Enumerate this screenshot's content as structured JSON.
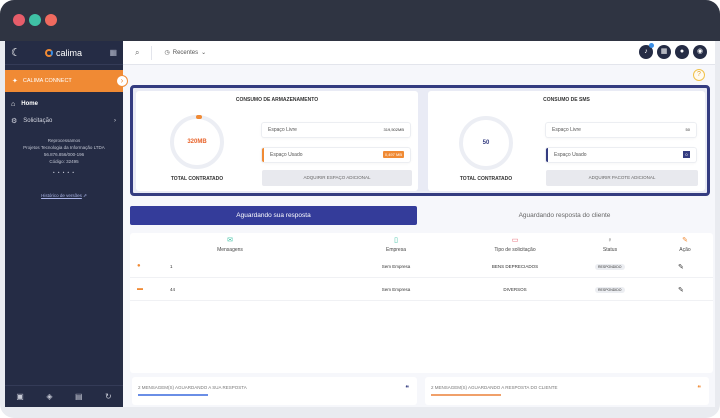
{
  "colors": {
    "brand_dark": "#252c45",
    "accent_orange": "#f08a34",
    "accent_indigo": "#343c9a",
    "accent_blue": "#3a8ee6"
  },
  "sidebar": {
    "brand": "calima",
    "connect_label": "CALIMA CONNECT",
    "items": [
      {
        "label": "Home",
        "icon": "home-icon"
      },
      {
        "label": "Solicitação",
        "icon": "settings-icon"
      }
    ],
    "info_lines": [
      "Reprocessamos",
      "Projetos Tecnologia da Informação LTDA",
      "56.876.856/000-196",
      "Código: 32495"
    ],
    "dots": "• • • • •",
    "link": "Histórico de versões",
    "footer_icons": [
      "calendar-icon",
      "layers-icon",
      "document-icon",
      "refresh-icon"
    ]
  },
  "topbar": {
    "recent_label": "Recentes"
  },
  "storage": {
    "title": "CONSUMO DE ARMAZENAMENTO",
    "total_value": "320MB",
    "total_label": "TOTAL CONTRATADO",
    "free_label": "Espaço Livre",
    "free_value": "319,502MB",
    "used_label": "Espaço Usado",
    "used_value": "0,497 MB",
    "add_button": "ADQUIRIR ESPAÇO ADICIONAL"
  },
  "sms": {
    "title": "CONSUMO DE SMS",
    "total_value": "50",
    "total_label": "TOTAL CONTRATADO",
    "free_label": "Espaço Livre",
    "free_value": "50",
    "used_label": "Espaço Usado",
    "used_value": "0",
    "add_button": "ADQUIRIR PACOTE ADICIONAL"
  },
  "tabs": {
    "active": "Aguardando sua resposta",
    "idle": "Aguardando resposta do cliente"
  },
  "table": {
    "headers": [
      "Mensagens",
      "Empresa",
      "Tipo de solicitação",
      "Status",
      "Ação"
    ],
    "rows": [
      {
        "messages": "1",
        "company": "Sem Empresa",
        "type": "BENS DEPRECIADOS",
        "status": "RESPONDIDO"
      },
      {
        "messages": "44",
        "company": "Sem Empresa",
        "type": "DIVERSOS",
        "status": "RESPONDIDO"
      }
    ]
  },
  "bottom": {
    "left": "2 MENSAGEM(S) AGUARDANDO A SUA RESPOSTA",
    "right": "2 MENSAGEM(S) AGUARDANDO A RESPOSTA DO CLIENTE"
  }
}
